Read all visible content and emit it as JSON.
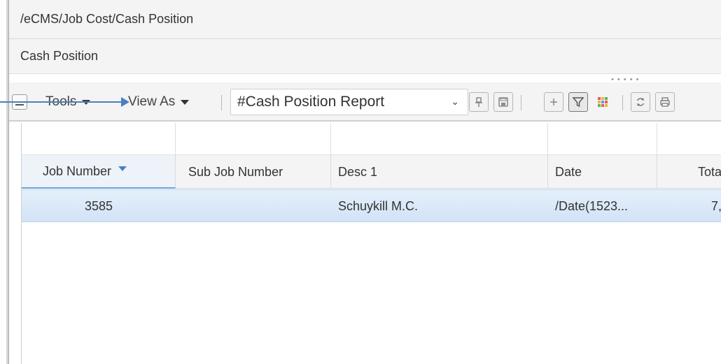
{
  "breadcrumb": "/eCMS/Job Cost/Cash Position",
  "page_title": "Cash Position",
  "toolbar": {
    "tools_label": "Tools",
    "view_as_label": "View As",
    "view_select_value": "#Cash Position Report",
    "icons": [
      "pin-icon",
      "save-icon",
      "add-icon",
      "filter-icon",
      "color-grid-icon",
      "refresh-icon",
      "print-icon"
    ]
  },
  "grid": {
    "columns": [
      "Job Number",
      "Sub Job Number",
      "Desc 1",
      "Date",
      "Tota"
    ],
    "rows": [
      [
        "3585",
        "",
        "Schuykill M.C.",
        "/Date(1523...",
        "7,"
      ]
    ]
  },
  "colors": {
    "accent": "#4a7fc1",
    "selected_row": "#d2e3f6"
  }
}
